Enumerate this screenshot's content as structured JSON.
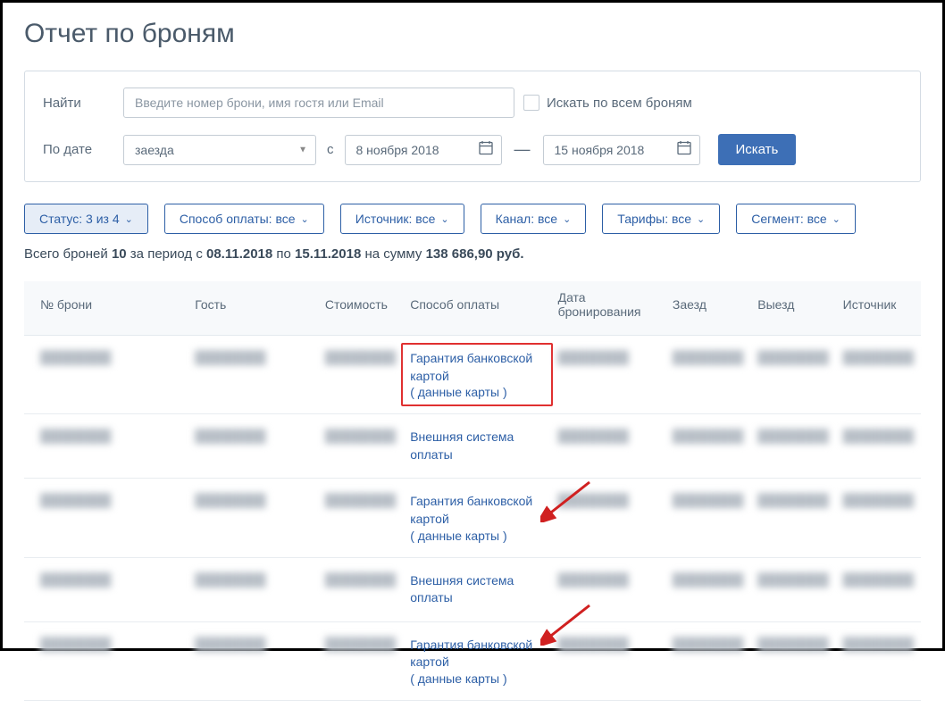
{
  "page": {
    "title": "Отчет по броням"
  },
  "search": {
    "find_label": "Найти",
    "placeholder": "Введите номер брони, имя гостя или Email",
    "search_all_label": "Искать по всем броням",
    "by_date_label": "По дате",
    "date_type_value": "заезда",
    "from_sep": "с",
    "date_from": "8 ноября 2018",
    "date_to": "15 ноября 2018",
    "search_button": "Искать"
  },
  "filters": {
    "status": "Статус: 3 из 4",
    "payment": "Способ оплаты: все",
    "source": "Источник: все",
    "channel": "Канал: все",
    "rates": "Тарифы: все",
    "segment": "Сегмент: все"
  },
  "summary": {
    "prefix": "Всего броней ",
    "count": "10",
    "mid1": " за период с ",
    "from": "08.11.2018",
    "mid2": " по ",
    "to": "15.11.2018",
    "mid3": " на сумму ",
    "amount": "138 686,90 руб."
  },
  "table": {
    "headers": {
      "booking_no": "№ брони",
      "guest": "Гость",
      "cost": "Стоимость",
      "payment_method": "Способ оплаты",
      "booking_date": "Дата бронирования",
      "checkin": "Заезд",
      "checkout": "Выезд",
      "source": "Источник"
    },
    "payment_texts": {
      "card_guarantee": "Гарантия банковской картой",
      "card_data": "( данные карты )",
      "external": "Внешняя система оплаты"
    },
    "rows": [
      {
        "payment_type": "card",
        "highlighted": true
      },
      {
        "payment_type": "external"
      },
      {
        "payment_type": "card",
        "arrow": true
      },
      {
        "payment_type": "external"
      },
      {
        "payment_type": "card",
        "arrow": true
      }
    ]
  }
}
